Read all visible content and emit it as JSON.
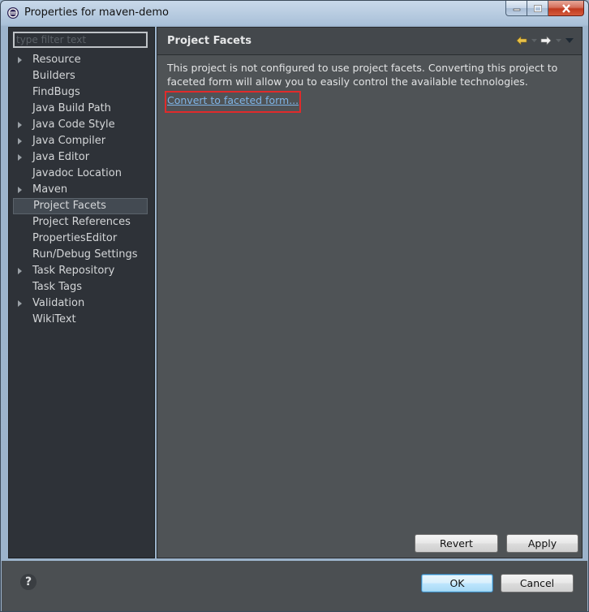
{
  "window": {
    "title": "Properties for maven-demo"
  },
  "filter": {
    "placeholder": "type filter text"
  },
  "tree": [
    {
      "label": "Resource",
      "expandable": true
    },
    {
      "label": "Builders",
      "expandable": false
    },
    {
      "label": "FindBugs",
      "expandable": false
    },
    {
      "label": "Java Build Path",
      "expandable": false
    },
    {
      "label": "Java Code Style",
      "expandable": true
    },
    {
      "label": "Java Compiler",
      "expandable": true
    },
    {
      "label": "Java Editor",
      "expandable": true
    },
    {
      "label": "Javadoc Location",
      "expandable": false
    },
    {
      "label": "Maven",
      "expandable": true
    },
    {
      "label": "Project Facets",
      "expandable": false,
      "selected": true
    },
    {
      "label": "Project References",
      "expandable": false
    },
    {
      "label": "PropertiesEditor",
      "expandable": false
    },
    {
      "label": "Run/Debug Settings",
      "expandable": false
    },
    {
      "label": "Task Repository",
      "expandable": true
    },
    {
      "label": "Task Tags",
      "expandable": false
    },
    {
      "label": "Validation",
      "expandable": true
    },
    {
      "label": "WikiText",
      "expandable": false
    }
  ],
  "page": {
    "title": "Project Facets",
    "description": "This project is not configured to use project facets. Converting this project to faceted form will allow you to easily control the available technologies.",
    "convert_link": "Convert to faceted form..."
  },
  "buttons": {
    "revert": "Revert",
    "apply": "Apply",
    "ok": "OK",
    "cancel": "Cancel",
    "help": "?"
  },
  "colors": {
    "highlight": "#e02b2b",
    "link": "#7fb4e6",
    "nav_back": "#e8c14a"
  }
}
